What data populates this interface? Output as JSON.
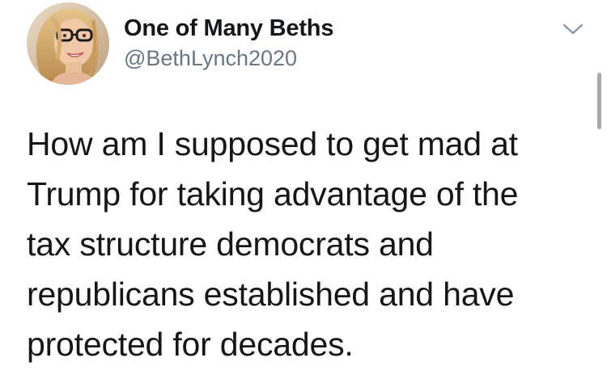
{
  "tweet": {
    "author": {
      "display_name": "One of Many Beths",
      "handle": "@BethLynch2020",
      "avatar_icon": "profile-photo"
    },
    "menu_icon": "chevron-down-icon",
    "text_lines": [
      "How am I supposed to get mad at",
      "Trump for taking advantage of the",
      "tax structure democrats and",
      "republicans established and have",
      "protected for decades."
    ]
  },
  "colors": {
    "name": "#14171a",
    "handle": "#657786",
    "chevron": "#8899a6",
    "background": "#ffffff"
  }
}
